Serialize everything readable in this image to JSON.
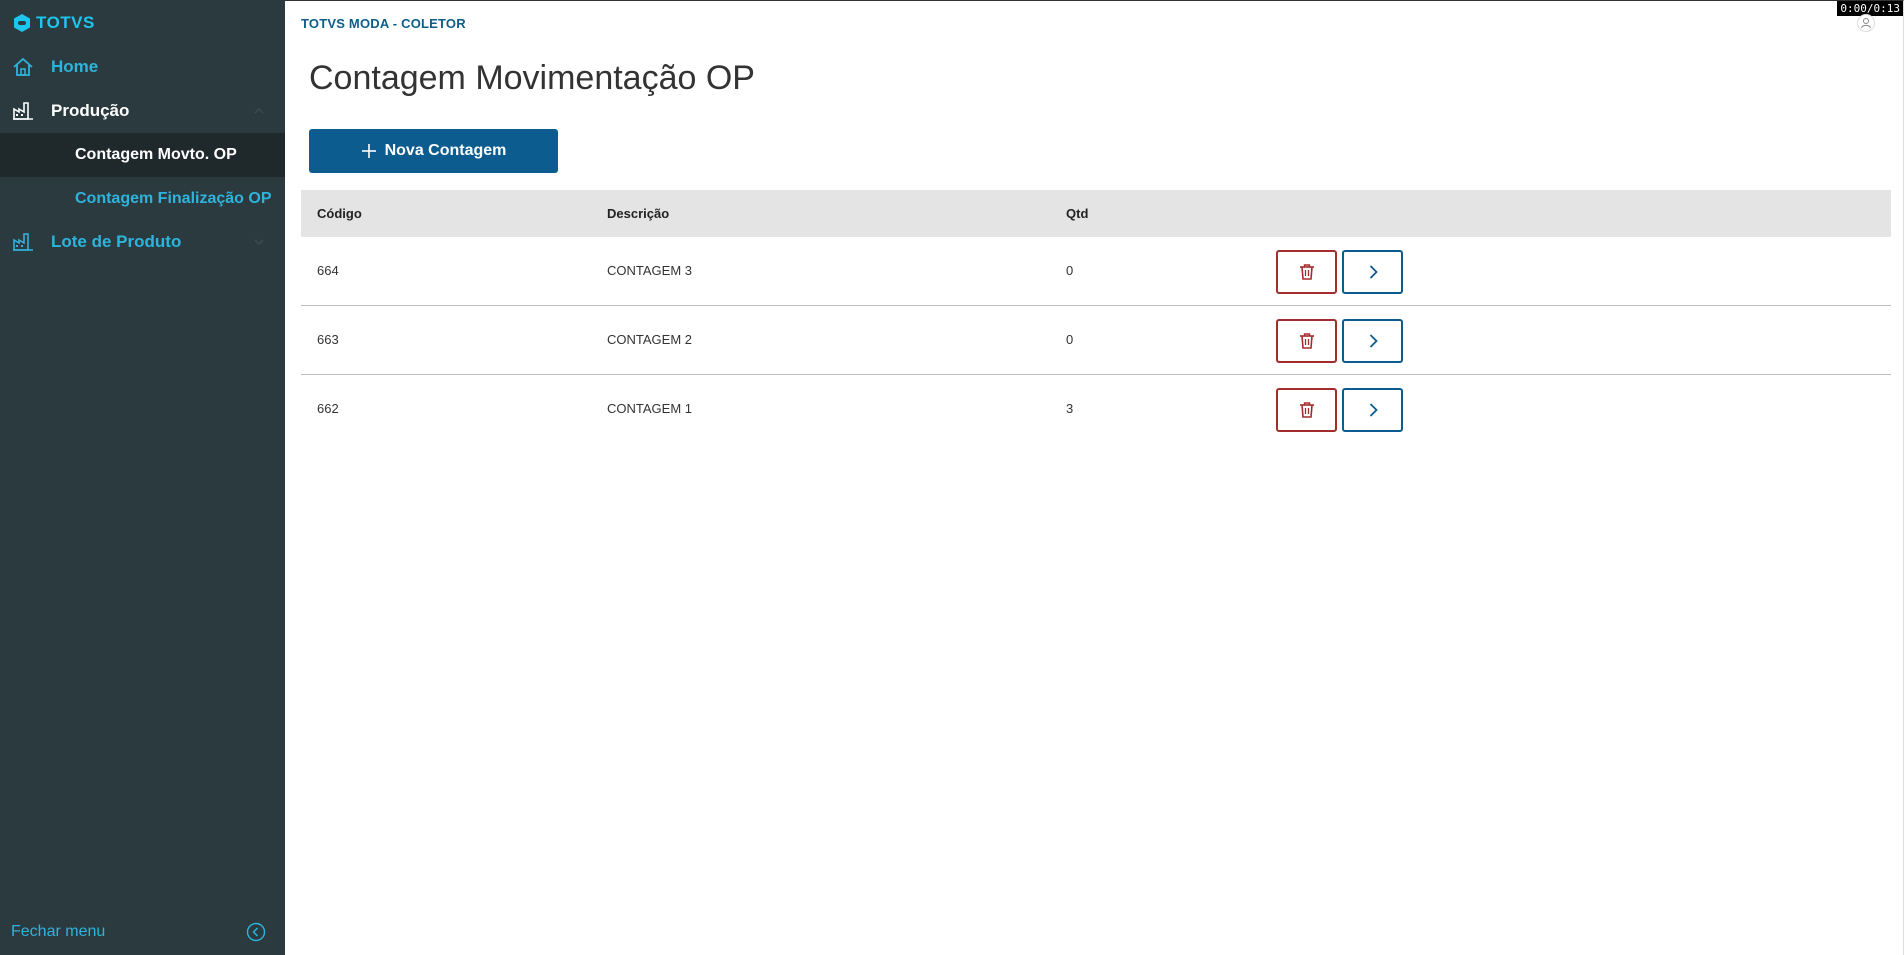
{
  "sidebar": {
    "logo_text": "TOTVS",
    "items": [
      {
        "label": "Home",
        "icon": "home-icon"
      },
      {
        "label": "Produção",
        "icon": "factory-icon"
      },
      {
        "label": "Lote de Produto",
        "icon": "factory-icon"
      }
    ],
    "subitems": [
      {
        "label": "Contagem Movto. OP",
        "active": true
      },
      {
        "label": "Contagem Finalização OP",
        "active": false
      }
    ],
    "close_menu_label": "Fechar menu"
  },
  "header": {
    "app_title": "TOTVS MODA - COLETOR",
    "timer": "0:00/0:13"
  },
  "main": {
    "page_title": "Contagem Movimentação OP",
    "new_button_label": "Nova Contagem"
  },
  "table": {
    "columns": [
      "Código",
      "Descrição",
      "Qtd"
    ],
    "rows": [
      {
        "codigo": "664",
        "descricao": "CONTAGEM 3",
        "qtd": "0"
      },
      {
        "codigo": "663",
        "descricao": "CONTAGEM 2",
        "qtd": "0"
      },
      {
        "codigo": "662",
        "descricao": "CONTAGEM 1",
        "qtd": "3"
      }
    ]
  },
  "colors": {
    "sidebar_bg": "#2b3a3e",
    "accent": "#2eb4dc",
    "primary": "#0c5c8f",
    "danger": "#a52c2c"
  }
}
